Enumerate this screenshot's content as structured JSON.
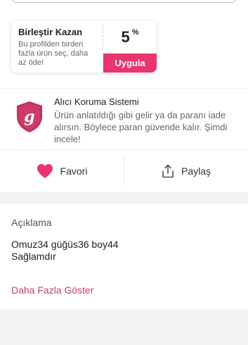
{
  "campaign": {
    "title": "Birleştir Kazan",
    "description": "Bu profilden birden fazla ürün seç, daha az öde!",
    "percent_value": "5",
    "percent_symbol": "%",
    "apply_label": "Uygula"
  },
  "buyer_protection": {
    "title": "Alıcı Koruma Sistemi",
    "text": "Ürün anlatıldığı gibi gelir ya da paranı iade alırsın. Böylece paran güvende kalır. Şimdi incele!",
    "icon": "shield-g-icon",
    "shield_color": "#c3305f"
  },
  "actions": {
    "favorite_label": "Favori",
    "share_label": "Paylaş",
    "favorite_icon": "heart-icon",
    "share_icon": "share-icon",
    "heart_color": "#e8356d"
  },
  "description": {
    "title": "Açıklama",
    "lines": [
      "Omuz34 güğüs36 boy44",
      "Sağlamdır"
    ],
    "show_more_label": "Daha Fazla Göster"
  },
  "colors": {
    "accent": "#e8356d",
    "link": "#c13d74"
  }
}
